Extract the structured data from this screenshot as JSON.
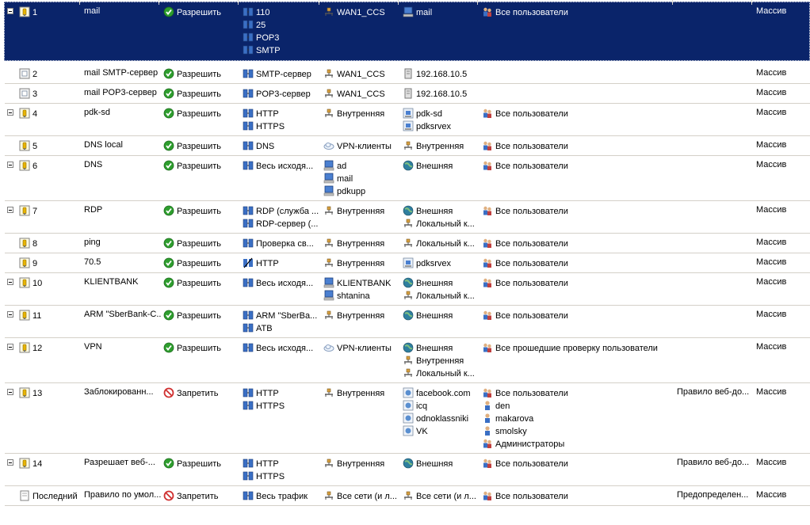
{
  "colors": {
    "selection": "#0a246a",
    "grid_line": "#d4d0c8",
    "allow": "#2e9e2e",
    "deny": "#d03030"
  },
  "rules": [
    {
      "num": "1",
      "name": "mail",
      "action": "Разрешить",
      "action_type": "allow",
      "rule_icon": "rule-icon",
      "proto_icon": "protocol-icon",
      "protocols": [
        "110",
        "25",
        "POP3",
        "SMTP"
      ],
      "from": [
        {
          "t": "WAN1_CCS",
          "i": "network-icon"
        }
      ],
      "to": [
        {
          "t": "mail",
          "i": "computer-icon"
        }
      ],
      "users": [
        {
          "t": "Все пользователи",
          "i": "users-icon"
        }
      ],
      "cond": "",
      "arr": "Массив",
      "selected": true,
      "expand": true
    },
    {
      "num": "2",
      "name": "mail SMTP-сервер",
      "action": "Разрешить",
      "action_type": "allow",
      "rule_icon": "publish-rule-icon",
      "proto_icon": "protocol-icon",
      "protocols": [
        "SMTP-сервер"
      ],
      "from": [
        {
          "t": "WAN1_CCS",
          "i": "network-icon"
        }
      ],
      "to": [
        {
          "t": "192.168.10.5",
          "i": "server-icon"
        }
      ],
      "users": [],
      "cond": "",
      "arr": "Массив",
      "selected": false,
      "expand": false
    },
    {
      "num": "3",
      "name": "mail POP3-сервер",
      "action": "Разрешить",
      "action_type": "allow",
      "rule_icon": "publish-rule-icon",
      "proto_icon": "protocol-icon",
      "protocols": [
        "POP3-сервер"
      ],
      "from": [
        {
          "t": "WAN1_CCS",
          "i": "network-icon"
        }
      ],
      "to": [
        {
          "t": "192.168.10.5",
          "i": "server-icon"
        }
      ],
      "users": [],
      "cond": "",
      "arr": "Массив",
      "selected": false,
      "expand": false
    },
    {
      "num": "4",
      "name": "pdk-sd",
      "action": "Разрешить",
      "action_type": "allow",
      "rule_icon": "rule-icon",
      "proto_icon": "protocol-icon",
      "protocols": [
        "HTTP",
        "HTTPS"
      ],
      "from": [
        {
          "t": "Внутренняя",
          "i": "network-icon"
        }
      ],
      "to": [
        {
          "t": "pdk-sd",
          "i": "computer-set-icon"
        },
        {
          "t": "pdksrvex",
          "i": "computer-set-icon"
        }
      ],
      "users": [
        {
          "t": "Все пользователи",
          "i": "users-icon"
        }
      ],
      "cond": "",
      "arr": "Массив",
      "selected": false,
      "expand": true
    },
    {
      "num": "5",
      "name": "DNS local",
      "action": "Разрешить",
      "action_type": "allow",
      "rule_icon": "rule-icon",
      "proto_icon": "protocol-icon",
      "protocols": [
        "DNS"
      ],
      "from": [
        {
          "t": "VPN-клиенты",
          "i": "cloud-icon"
        }
      ],
      "to": [
        {
          "t": "Внутренняя",
          "i": "network-icon"
        }
      ],
      "users": [
        {
          "t": "Все пользователи",
          "i": "users-icon"
        }
      ],
      "cond": "",
      "arr": "Массив",
      "selected": false,
      "expand": false
    },
    {
      "num": "6",
      "name": "DNS",
      "action": "Разрешить",
      "action_type": "allow",
      "rule_icon": "rule-icon",
      "proto_icon": "protocol-icon",
      "protocols": [
        "Весь исходя..."
      ],
      "from": [
        {
          "t": "ad",
          "i": "computer-icon"
        },
        {
          "t": "mail",
          "i": "computer-icon"
        },
        {
          "t": "pdkupp",
          "i": "computer-icon"
        }
      ],
      "to": [
        {
          "t": "Внешняя",
          "i": "globe-icon"
        }
      ],
      "users": [
        {
          "t": "Все пользователи",
          "i": "users-icon"
        }
      ],
      "cond": "",
      "arr": "Массив",
      "selected": false,
      "expand": true
    },
    {
      "num": "7",
      "name": "RDP",
      "action": "Разрешить",
      "action_type": "allow",
      "rule_icon": "rule-icon",
      "proto_icon": "protocol-icon",
      "protocols": [
        "RDP (служба ...",
        "RDP-сервер (..."
      ],
      "from": [
        {
          "t": "Внутренняя",
          "i": "network-icon"
        }
      ],
      "to": [
        {
          "t": "Внешняя",
          "i": "globe-icon"
        },
        {
          "t": "Локальный к...",
          "i": "network-icon"
        }
      ],
      "users": [
        {
          "t": "Все пользователи",
          "i": "users-icon"
        }
      ],
      "cond": "",
      "arr": "Массив",
      "selected": false,
      "expand": true
    },
    {
      "num": "8",
      "name": "ping",
      "action": "Разрешить",
      "action_type": "allow",
      "rule_icon": "rule-icon",
      "proto_icon": "protocol-icon",
      "protocols": [
        "Проверка св..."
      ],
      "from": [
        {
          "t": "Внутренняя",
          "i": "network-icon"
        }
      ],
      "to": [
        {
          "t": "Локальный к...",
          "i": "network-icon"
        }
      ],
      "users": [
        {
          "t": "Все пользователи",
          "i": "users-icon"
        }
      ],
      "cond": "",
      "arr": "Массив",
      "selected": false,
      "expand": false
    },
    {
      "num": "9",
      "name": "70.5",
      "action": "Разрешить",
      "action_type": "allow",
      "rule_icon": "rule-icon",
      "proto_icon": "protocol-edit-icon",
      "protocols": [
        "HTTP"
      ],
      "from": [
        {
          "t": "Внутренняя",
          "i": "network-icon"
        }
      ],
      "to": [
        {
          "t": "pdksrvex",
          "i": "computer-set-icon"
        }
      ],
      "users": [
        {
          "t": "Все пользователи",
          "i": "users-icon"
        }
      ],
      "cond": "",
      "arr": "Массив",
      "selected": false,
      "expand": false
    },
    {
      "num": "10",
      "name": "KLIENTBANK",
      "action": "Разрешить",
      "action_type": "allow",
      "rule_icon": "rule-icon",
      "proto_icon": "protocol-icon",
      "protocols": [
        "Весь исходя..."
      ],
      "from": [
        {
          "t": "KLIENTBANK",
          "i": "computer-icon"
        },
        {
          "t": "shtanina",
          "i": "computer-icon"
        }
      ],
      "to": [
        {
          "t": "Внешняя",
          "i": "globe-icon"
        },
        {
          "t": "Локальный к...",
          "i": "network-icon"
        }
      ],
      "users": [
        {
          "t": "Все пользователи",
          "i": "users-icon"
        }
      ],
      "cond": "",
      "arr": "Массив",
      "selected": false,
      "expand": true
    },
    {
      "num": "11",
      "name": "ARM \"SberBank-C...",
      "action": "Разрешить",
      "action_type": "allow",
      "rule_icon": "rule-icon",
      "proto_icon": "protocol-icon",
      "protocols": [
        "ARM \"SberBa...",
        "ATB"
      ],
      "from": [
        {
          "t": "Внутренняя",
          "i": "network-icon"
        }
      ],
      "to": [
        {
          "t": "Внешняя",
          "i": "globe-icon"
        }
      ],
      "users": [
        {
          "t": "Все пользователи",
          "i": "users-icon"
        }
      ],
      "cond": "",
      "arr": "Массив",
      "selected": false,
      "expand": true
    },
    {
      "num": "12",
      "name": "VPN",
      "action": "Разрешить",
      "action_type": "allow",
      "rule_icon": "rule-icon",
      "proto_icon": "protocol-icon",
      "protocols": [
        "Весь исходя..."
      ],
      "from": [
        {
          "t": "VPN-клиенты",
          "i": "cloud-icon"
        }
      ],
      "to": [
        {
          "t": "Внешняя",
          "i": "globe-icon"
        },
        {
          "t": "Внутренняя",
          "i": "network-icon"
        },
        {
          "t": "Локальный к...",
          "i": "network-icon"
        }
      ],
      "users": [
        {
          "t": "Все прошедшие проверку пользователи",
          "i": "users-icon"
        }
      ],
      "cond": "",
      "arr": "Массив",
      "selected": false,
      "expand": true
    },
    {
      "num": "13",
      "name": "Заблокированн...",
      "action": "Запретить",
      "action_type": "deny",
      "rule_icon": "rule-icon",
      "proto_icon": "protocol-icon",
      "protocols": [
        "HTTP",
        "HTTPS"
      ],
      "from": [
        {
          "t": "Внутренняя",
          "i": "network-icon"
        }
      ],
      "to": [
        {
          "t": "facebook.com",
          "i": "url-set-icon"
        },
        {
          "t": "icq",
          "i": "url-set-icon"
        },
        {
          "t": "odnoklassniki",
          "i": "url-set-icon"
        },
        {
          "t": "VK",
          "i": "url-set-icon"
        }
      ],
      "users": [
        {
          "t": "Все пользователи",
          "i": "users-icon"
        },
        {
          "t": "den",
          "i": "user-icon"
        },
        {
          "t": "makarova",
          "i": "user-icon"
        },
        {
          "t": "smolsky",
          "i": "user-icon"
        },
        {
          "t": "Администраторы",
          "i": "users-icon"
        }
      ],
      "cond": "Правило веб-до...",
      "arr": "Массив",
      "selected": false,
      "expand": true
    },
    {
      "num": "14",
      "name": "Разрешает веб-...",
      "action": "Разрешить",
      "action_type": "allow",
      "rule_icon": "rule-icon",
      "proto_icon": "protocol-icon",
      "protocols": [
        "HTTP",
        "HTTPS"
      ],
      "from": [
        {
          "t": "Внутренняя",
          "i": "network-icon"
        }
      ],
      "to": [
        {
          "t": "Внешняя",
          "i": "globe-icon"
        }
      ],
      "users": [
        {
          "t": "Все пользователи",
          "i": "users-icon"
        }
      ],
      "cond": "Правило веб-до...",
      "arr": "Массив",
      "selected": false,
      "expand": true
    },
    {
      "num": "Последний",
      "name": "Правило по умол...",
      "action": "Запретить",
      "action_type": "deny",
      "rule_icon": "default-rule-icon",
      "proto_icon": "protocol-icon",
      "protocols": [
        "Весь трафик"
      ],
      "from": [
        {
          "t": "Все сети (и л...",
          "i": "network-icon"
        }
      ],
      "to": [
        {
          "t": "Все сети (и л...",
          "i": "network-icon"
        }
      ],
      "users": [
        {
          "t": "Все пользователи",
          "i": "users-icon"
        }
      ],
      "cond": "Предопределен...",
      "arr": "Массив",
      "selected": false,
      "expand": false
    }
  ]
}
